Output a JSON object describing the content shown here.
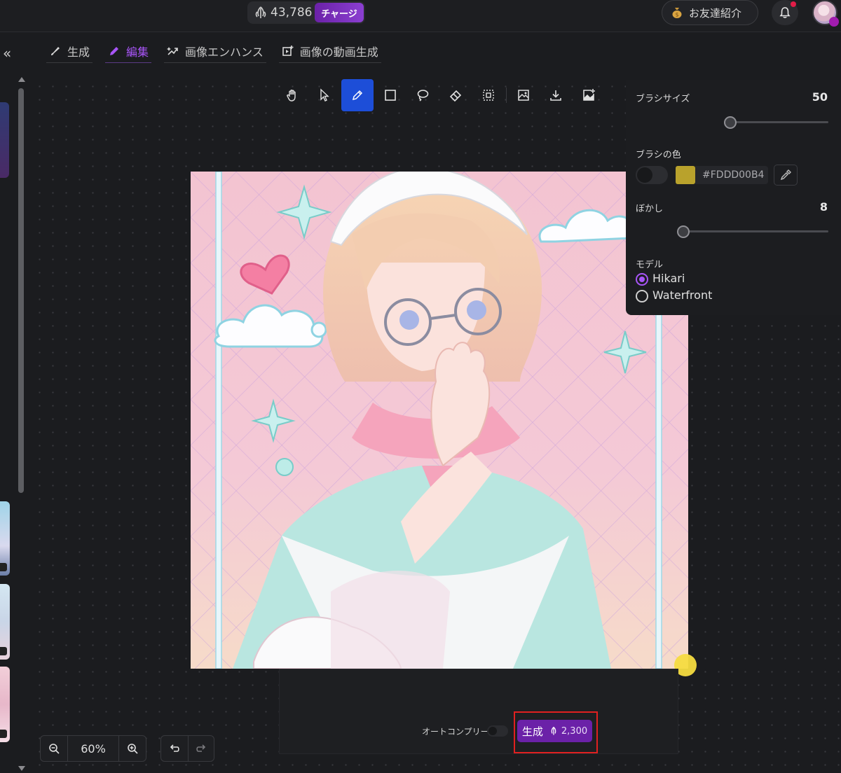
{
  "topbar": {
    "credits": "43,786",
    "charge_label": "チャージ",
    "invite_label": "お友達紹介"
  },
  "nav": {
    "tabs": [
      {
        "label": "生成",
        "icon": "brush-icon",
        "active": false
      },
      {
        "label": "編集",
        "icon": "pencil-icon",
        "active": true
      },
      {
        "label": "画像エンハンス",
        "icon": "enhance-icon",
        "active": false
      },
      {
        "label": "画像の動画生成",
        "icon": "video-generate-icon",
        "active": false
      }
    ]
  },
  "toolbar": {
    "tools": [
      "hand-icon",
      "pointer-icon",
      "pen-icon",
      "rectangle-icon",
      "lasso-icon",
      "eraser-icon",
      "select-frame-icon",
      "image-icon",
      "download-icon",
      "add-image-icon"
    ],
    "active_tool": "pen-icon"
  },
  "brush_panel": {
    "size_label": "ブラシサイズ",
    "size_value": "50",
    "size_fraction": 0.05,
    "color_label": "ブラシの色",
    "color_hex": "#FDDD00B4",
    "swatch_color": "#b9a22c",
    "blur_label": "ぼかし",
    "blur_value": "8",
    "blur_fraction": 0.0,
    "model_label": "モデル",
    "models": [
      {
        "label": "Hikari",
        "selected": true
      },
      {
        "label": "Waterfront",
        "selected": false
      }
    ]
  },
  "prompt_panel": {
    "autocomplete_label": "オートコンプリート",
    "generate_label": "生成",
    "generate_cost": "2,300"
  },
  "zoom": {
    "value": "60%"
  },
  "colors": {
    "accent": "#a855f7",
    "active_tool": "#1d4ed8",
    "generate_button": "#6b21a8",
    "highlight": "#e02020",
    "brush_cursor": "#f5dc40"
  }
}
